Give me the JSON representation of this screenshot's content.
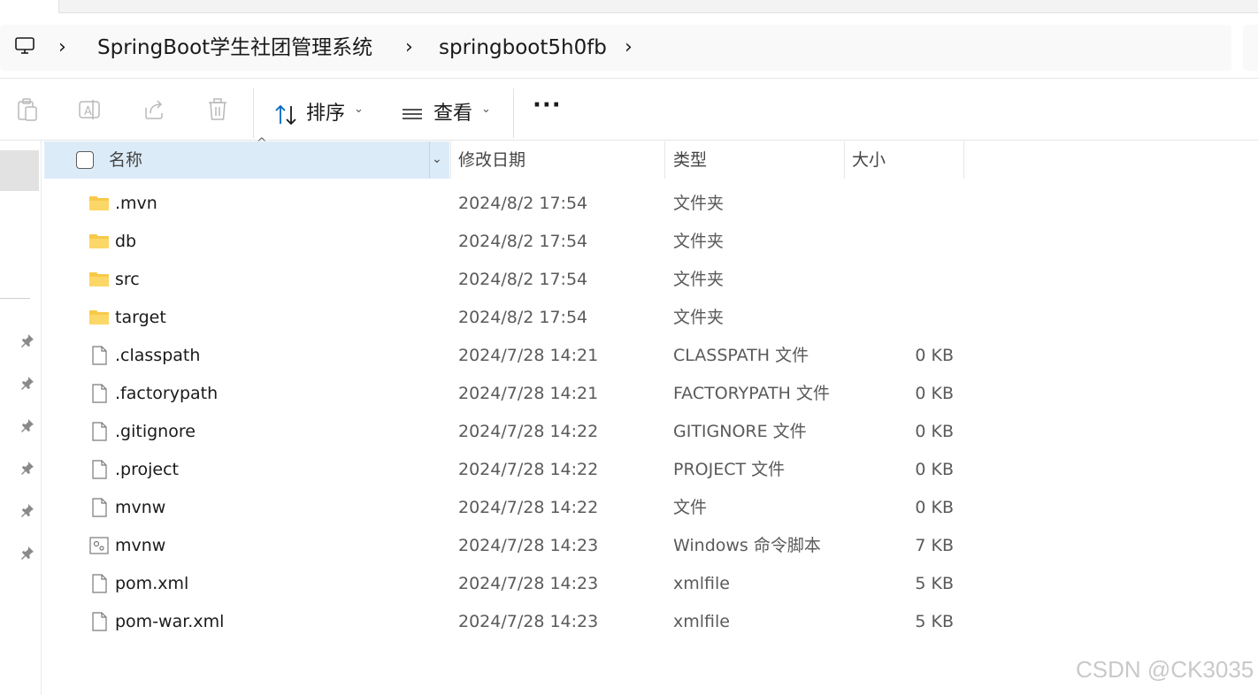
{
  "breadcrumb": {
    "items": [
      "SpringBoot学生社团管理系统",
      "springboot5h0fb"
    ]
  },
  "toolbar": {
    "sort_label": "排序",
    "view_label": "查看",
    "more_label": "···"
  },
  "columns": {
    "name": "名称",
    "date": "修改日期",
    "type": "类型",
    "size": "大小"
  },
  "files": [
    {
      "name": ".mvn",
      "date": "2024/8/2 17:54",
      "type": "文件夹",
      "size": "",
      "icon": "folder-icon"
    },
    {
      "name": "db",
      "date": "2024/8/2 17:54",
      "type": "文件夹",
      "size": "",
      "icon": "folder-icon"
    },
    {
      "name": "src",
      "date": "2024/8/2 17:54",
      "type": "文件夹",
      "size": "",
      "icon": "folder-icon"
    },
    {
      "name": "target",
      "date": "2024/8/2 17:54",
      "type": "文件夹",
      "size": "",
      "icon": "folder-icon"
    },
    {
      "name": ".classpath",
      "date": "2024/7/28 14:21",
      "type": "CLASSPATH 文件",
      "size": "0 KB",
      "icon": "file-icon"
    },
    {
      "name": ".factorypath",
      "date": "2024/7/28 14:21",
      "type": "FACTORYPATH 文件",
      "size": "0 KB",
      "icon": "file-icon"
    },
    {
      "name": ".gitignore",
      "date": "2024/7/28 14:22",
      "type": "GITIGNORE 文件",
      "size": "0 KB",
      "icon": "file-icon"
    },
    {
      "name": ".project",
      "date": "2024/7/28 14:22",
      "type": "PROJECT 文件",
      "size": "0 KB",
      "icon": "file-icon"
    },
    {
      "name": "mvnw",
      "date": "2024/7/28 14:22",
      "type": "文件",
      "size": "0 KB",
      "icon": "file-icon"
    },
    {
      "name": "mvnw",
      "date": "2024/7/28 14:23",
      "type": "Windows 命令脚本",
      "size": "7 KB",
      "icon": "script-icon"
    },
    {
      "name": "pom.xml",
      "date": "2024/7/28 14:23",
      "type": "xmlfile",
      "size": "5 KB",
      "icon": "file-icon"
    },
    {
      "name": "pom-war.xml",
      "date": "2024/7/28 14:23",
      "type": "xmlfile",
      "size": "5 KB",
      "icon": "file-icon"
    }
  ],
  "watermark": "CSDN @CK3035",
  "colors": {
    "header_selected": "#dcebf8",
    "folder_yellow": "#f7c948",
    "accent": "#0067c0"
  }
}
